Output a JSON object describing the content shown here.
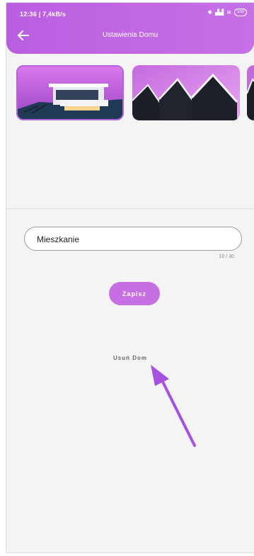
{
  "status_bar": {
    "time": "12:36 | 7,4kB/s",
    "battery": "100"
  },
  "header": {
    "title": "Ustawienia Domu"
  },
  "house_images": [
    {
      "name": "modern-house-image",
      "selected": true
    },
    {
      "name": "gable-roof-houses-image",
      "selected": false
    },
    {
      "name": "partial-house-image",
      "selected": false
    }
  ],
  "form": {
    "house_name_value": "Mieszkanie",
    "char_counter": "10 / 30",
    "save_label": "Zapisz"
  },
  "delete_label": "Usuń Dom",
  "colors": {
    "accent": "#c66fe3",
    "header": "#b95ee0",
    "annotation_arrow": "#a552e0"
  }
}
